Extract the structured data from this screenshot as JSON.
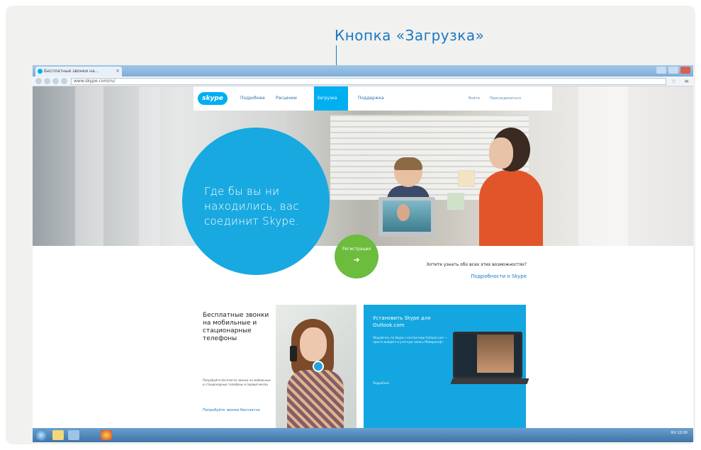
{
  "callout": {
    "text": "Кнопка «Загрузка»"
  },
  "browser": {
    "tab_title": "Бесплатные звонки на...",
    "tab_close": "×",
    "url": "www.skype.com/ru/",
    "star_icon": "star-icon",
    "menu_icon": "menu-icon"
  },
  "site": {
    "logo": "skype",
    "nav": [
      {
        "label": "Подробнее"
      },
      {
        "label": "Расценки"
      },
      {
        "label": "Загрузка"
      },
      {
        "label": "Поддержка"
      }
    ],
    "nav_right": [
      {
        "label": "Войти"
      },
      {
        "label": "Присоединиться"
      }
    ],
    "hero_text": "Где бы вы ни находились, вас соединит Skype.",
    "register_label": "Регистрация",
    "register_arrow": "➜",
    "question": "Хотите узнать обо всех этих возможностях?",
    "more_link": "Подробности о Skype"
  },
  "promo_left": {
    "title": "Бесплатные звонки на мобильные и стационарные телефоны",
    "body": "Попробуйте бесплатно звонки на мобильные и стационарные телефоны в первый месяц",
    "link": "Попробуйте звонки бесплатно"
  },
  "promo_right": {
    "title": "Установить Skype для Outlook.com",
    "body": "Общайтесь по Skype с контактами Outlook.com — просто войдите в учетную запись Майкрософт",
    "link": "Подробнее"
  },
  "taskbar": {
    "tray_text": "RU  12:00"
  },
  "colors": {
    "accent": "#00aff0",
    "callout": "#1a78c2",
    "register": "#6cbc3d"
  }
}
